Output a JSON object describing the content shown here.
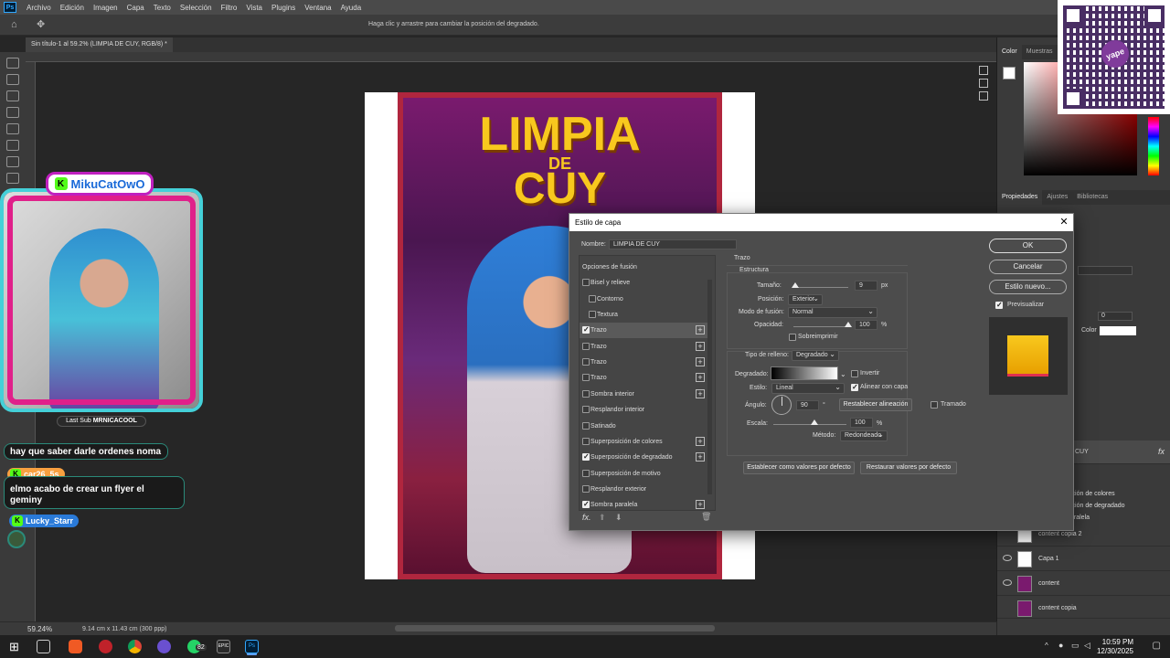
{
  "menubar": {
    "logo": "Ps",
    "items": [
      "Archivo",
      "Edición",
      "Imagen",
      "Capa",
      "Texto",
      "Selección",
      "Filtro",
      "Vista",
      "Plugins",
      "Ventana",
      "Ayuda"
    ]
  },
  "optbar": {
    "hint": "Haga clic y arrastre para cambiar la posición del degradado."
  },
  "doc_tab": "Sin título-1 al 59.2% (LIMPIA DE CUY, RGB/8) *",
  "poster": {
    "line1": "LIMPIA",
    "line2": "DE",
    "line3": "CUY"
  },
  "status": {
    "zoom": "59.24%",
    "dims": "9.14 cm x 11.43 cm (300 ppp)"
  },
  "panels": {
    "color_tabs": [
      "Color",
      "Muestras"
    ],
    "prop_tabs": [
      "Propiedades",
      "Ajustes",
      "Bibliotecas"
    ],
    "fields": {
      "val0": "0",
      "color_label": "Color"
    },
    "layers_partial": [
      "ición de colores",
      "ición de degradado",
      "aralela"
    ],
    "layers": [
      {
        "name": "CUY"
      },
      {
        "name": "content copia 2"
      },
      {
        "name": "Capa 1"
      },
      {
        "name": "content"
      },
      {
        "name": "content copia"
      }
    ]
  },
  "qr": {
    "brand": "yape"
  },
  "stream": {
    "cam_name": "MikuCatOwO",
    "last_sub_label": "Last Sub",
    "last_sub_name": "MRNICACOOL",
    "chat": [
      {
        "user": "",
        "text": "hay que saber darle ordenes noma"
      },
      {
        "user": "car26_5s",
        "text": "elmo acabo de crear un flyer el geminy"
      },
      {
        "user": "Lucky_Starr",
        "text": ""
      }
    ]
  },
  "taskbar": {
    "time": "10:59 PM",
    "date": "12/30/2025",
    "badge": "82",
    "epic": "EPIC"
  },
  "dialog": {
    "title": "Estilo de capa",
    "name_label": "Nombre:",
    "name_value": "LIMPIA DE CUY",
    "list": [
      {
        "label": "Opciones de fusión",
        "check": null,
        "plus": false,
        "indent": false,
        "selected": false
      },
      {
        "label": "Bisel y relieve",
        "check": false,
        "plus": false,
        "indent": false,
        "selected": false
      },
      {
        "label": "Contorno",
        "check": false,
        "plus": false,
        "indent": true,
        "selected": false
      },
      {
        "label": "Textura",
        "check": false,
        "plus": false,
        "indent": true,
        "selected": false
      },
      {
        "label": "Trazo",
        "check": true,
        "plus": true,
        "indent": false,
        "selected": true
      },
      {
        "label": "Trazo",
        "check": false,
        "plus": true,
        "indent": false,
        "selected": false
      },
      {
        "label": "Trazo",
        "check": false,
        "plus": true,
        "indent": false,
        "selected": false
      },
      {
        "label": "Trazo",
        "check": false,
        "plus": true,
        "indent": false,
        "selected": false
      },
      {
        "label": "Sombra interior",
        "check": false,
        "plus": true,
        "indent": false,
        "selected": false
      },
      {
        "label": "Resplandor interior",
        "check": false,
        "plus": false,
        "indent": false,
        "selected": false
      },
      {
        "label": "Satinado",
        "check": false,
        "plus": false,
        "indent": false,
        "selected": false
      },
      {
        "label": "Superposición de colores",
        "check": false,
        "plus": true,
        "indent": false,
        "selected": false
      },
      {
        "label": "Superposición de degradado",
        "check": true,
        "plus": true,
        "indent": false,
        "selected": false
      },
      {
        "label": "Superposición de motivo",
        "check": false,
        "plus": false,
        "indent": false,
        "selected": false
      },
      {
        "label": "Resplandor exterior",
        "check": false,
        "plus": false,
        "indent": false,
        "selected": false
      },
      {
        "label": "Sombra paralela",
        "check": true,
        "plus": true,
        "indent": false,
        "selected": false
      }
    ],
    "fx": "fx.",
    "section": "Trazo",
    "structure": "Estructura",
    "size_label": "Tamaño:",
    "size_value": "9",
    "size_unit": "px",
    "position_label": "Posición:",
    "position_value": "Exterior",
    "blend_label": "Modo de fusión:",
    "blend_value": "Normal",
    "opacity_label": "Opacidad:",
    "opacity_value": "100",
    "opacity_unit": "%",
    "overprint": "Sobreimprimir",
    "fill_type_label": "Tipo de relleno:",
    "fill_type_value": "Degradado",
    "gradient_label": "Degradado:",
    "invert": "Invertir",
    "style_label": "Estilo:",
    "style_value": "Lineal",
    "align": "Alinear con capa",
    "angle_label": "Ángulo:",
    "angle_value": "90",
    "angle_unit": "°",
    "reset_align": "Restablecer alineación",
    "dither": "Tramado",
    "scale_label": "Escala:",
    "scale_value": "100",
    "scale_unit": "%",
    "method_label": "Método:",
    "method_value": "Redondeado",
    "set_default": "Establecer como valores por defecto",
    "restore_default": "Restaurar valores por defecto",
    "ok": "OK",
    "cancel": "Cancelar",
    "new_style": "Estilo nuevo...",
    "preview": "Previsualizar"
  }
}
